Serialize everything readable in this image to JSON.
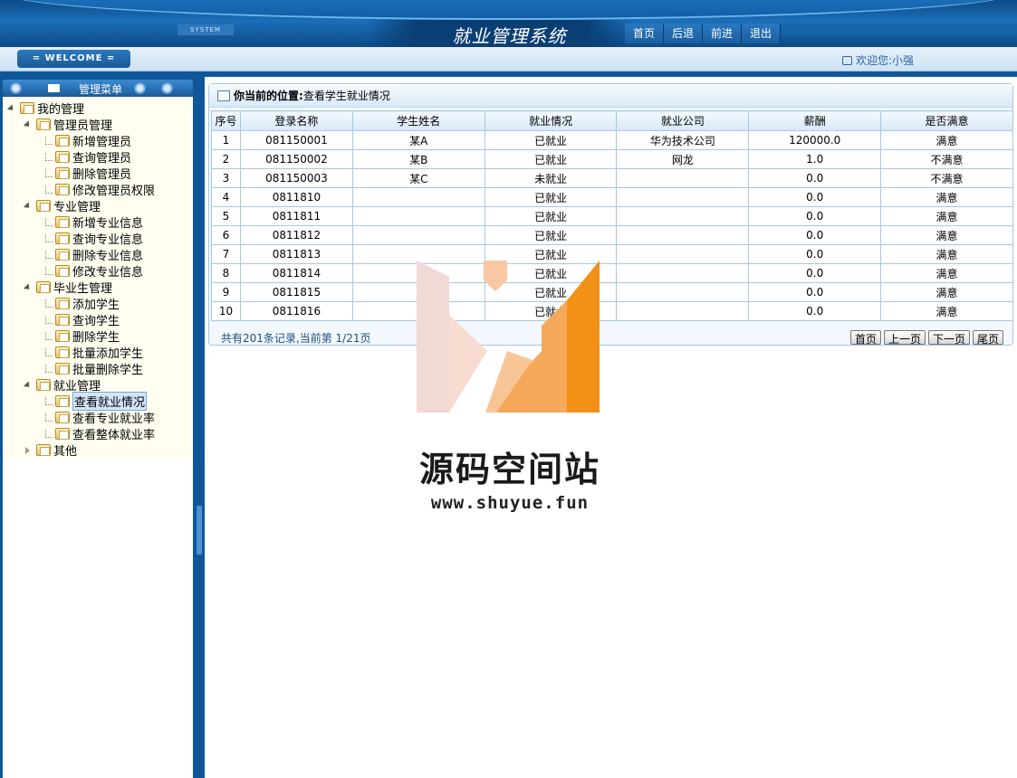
{
  "header": {
    "system_tag": "SYSTEM",
    "title": "就业管理系统",
    "nav": [
      "首页",
      "后退",
      "前进",
      "退出"
    ]
  },
  "strip": {
    "welcome": "= WELCOME =",
    "greeting": "欢迎您:小强"
  },
  "sidebar": {
    "title": "管理菜单",
    "tree": [
      {
        "label": "我的管理",
        "level": 0,
        "icon": "folder-icon"
      },
      {
        "label": "管理员管理",
        "level": 1,
        "icon": "folder-icon"
      },
      {
        "label": "新增管理员",
        "level": 2,
        "icon": "folder-icon"
      },
      {
        "label": "查询管理员",
        "level": 2,
        "icon": "folder-icon"
      },
      {
        "label": "删除管理员",
        "level": 2,
        "icon": "folder-icon"
      },
      {
        "label": "修改管理员权限",
        "level": 2,
        "icon": "folder-icon"
      },
      {
        "label": "专业管理",
        "level": 1,
        "icon": "folder-icon"
      },
      {
        "label": "新增专业信息",
        "level": 2,
        "icon": "folder-icon"
      },
      {
        "label": "查询专业信息",
        "level": 2,
        "icon": "folder-icon"
      },
      {
        "label": "删除专业信息",
        "level": 2,
        "icon": "folder-icon"
      },
      {
        "label": "修改专业信息",
        "level": 2,
        "icon": "folder-icon"
      },
      {
        "label": "毕业生管理",
        "level": 1,
        "icon": "folder-icon"
      },
      {
        "label": "添加学生",
        "level": 2,
        "icon": "folder-icon"
      },
      {
        "label": "查询学生",
        "level": 2,
        "icon": "folder-icon"
      },
      {
        "label": "删除学生",
        "level": 2,
        "icon": "folder-icon"
      },
      {
        "label": "批量添加学生",
        "level": 2,
        "icon": "folder-icon"
      },
      {
        "label": "批量删除学生",
        "level": 2,
        "icon": "folder-icon"
      },
      {
        "label": "就业管理",
        "level": 1,
        "icon": "folder-icon"
      },
      {
        "label": "查看就业情况",
        "level": 2,
        "icon": "folder-icon",
        "selected": true
      },
      {
        "label": "查看专业就业率",
        "level": 2,
        "icon": "folder-icon"
      },
      {
        "label": "查看整体就业率",
        "level": 2,
        "icon": "folder-icon"
      },
      {
        "label": "其他",
        "level": 1,
        "icon": "folder-icon",
        "collapsed": true
      }
    ]
  },
  "main": {
    "breadcrumb_label": "你当前的位置:",
    "breadcrumb_value": "查看学生就业情况",
    "table": {
      "headers": [
        "序号",
        "登录名称",
        "学生姓名",
        "就业情况",
        "就业公司",
        "薪酬",
        "是否满意"
      ],
      "rows": [
        [
          "1",
          "081150001",
          "某A",
          "已就业",
          "华为技术公司",
          "120000.0",
          "满意"
        ],
        [
          "2",
          "081150002",
          "某B",
          "已就业",
          "网龙",
          "1.0",
          "不满意"
        ],
        [
          "3",
          "081150003",
          "某C",
          "未就业",
          "",
          "0.0",
          "不满意"
        ],
        [
          "4",
          "0811810",
          "",
          "已就业",
          "",
          "0.0",
          "满意"
        ],
        [
          "5",
          "0811811",
          "",
          "已就业",
          "",
          "0.0",
          "满意"
        ],
        [
          "6",
          "0811812",
          "",
          "已就业",
          "",
          "0.0",
          "满意"
        ],
        [
          "7",
          "0811813",
          "",
          "已就业",
          "",
          "0.0",
          "满意"
        ],
        [
          "8",
          "0811814",
          "",
          "已就业",
          "",
          "0.0",
          "满意"
        ],
        [
          "9",
          "0811815",
          "",
          "已就业",
          "",
          "0.0",
          "满意"
        ],
        [
          "10",
          "0811816",
          "",
          "已就业",
          "",
          "0.0",
          "满意"
        ]
      ]
    },
    "pager": {
      "summary": "共有201条记录,当前第 1/21页",
      "buttons": [
        "首页",
        "上一页",
        "下一页",
        "尾页"
      ]
    }
  },
  "watermark": {
    "text": "源码空间站",
    "url": "www.shuyue.fun",
    "colors": {
      "pale": "#f1d9d6",
      "mid": "#f6a85a",
      "strong": "#f39016"
    }
  }
}
